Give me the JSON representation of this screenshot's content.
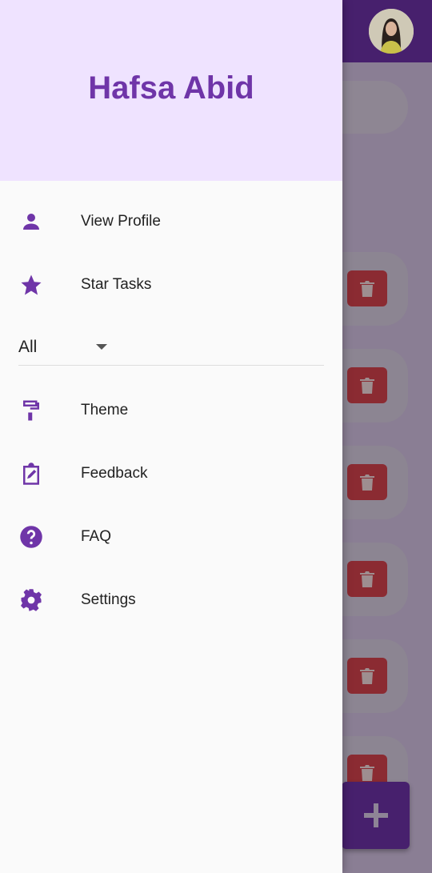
{
  "colors": {
    "primary": "#6f35a8",
    "app_bar": "#47206d",
    "drawer_header": "#efe3ff",
    "delete": "#8b2b32"
  },
  "app_bar": {
    "avatar_icon": "profile-photo"
  },
  "drawer": {
    "header": {
      "name": "Hafsa Abid"
    },
    "items_top": [
      {
        "label": "View Profile",
        "icon": "person-icon"
      },
      {
        "label": "Star Tasks",
        "icon": "star-icon"
      }
    ],
    "filter": {
      "selected": "All"
    },
    "items_bottom": [
      {
        "label": "Theme",
        "icon": "paint-roller-icon"
      },
      {
        "label": "Feedback",
        "icon": "clipboard-edit-icon"
      },
      {
        "label": "FAQ",
        "icon": "help-circle-icon"
      },
      {
        "label": "Settings",
        "icon": "gear-icon"
      }
    ]
  },
  "background_list": {
    "task_count": 6,
    "delete_icon": "trash-icon",
    "fab_icon": "plus-icon"
  }
}
